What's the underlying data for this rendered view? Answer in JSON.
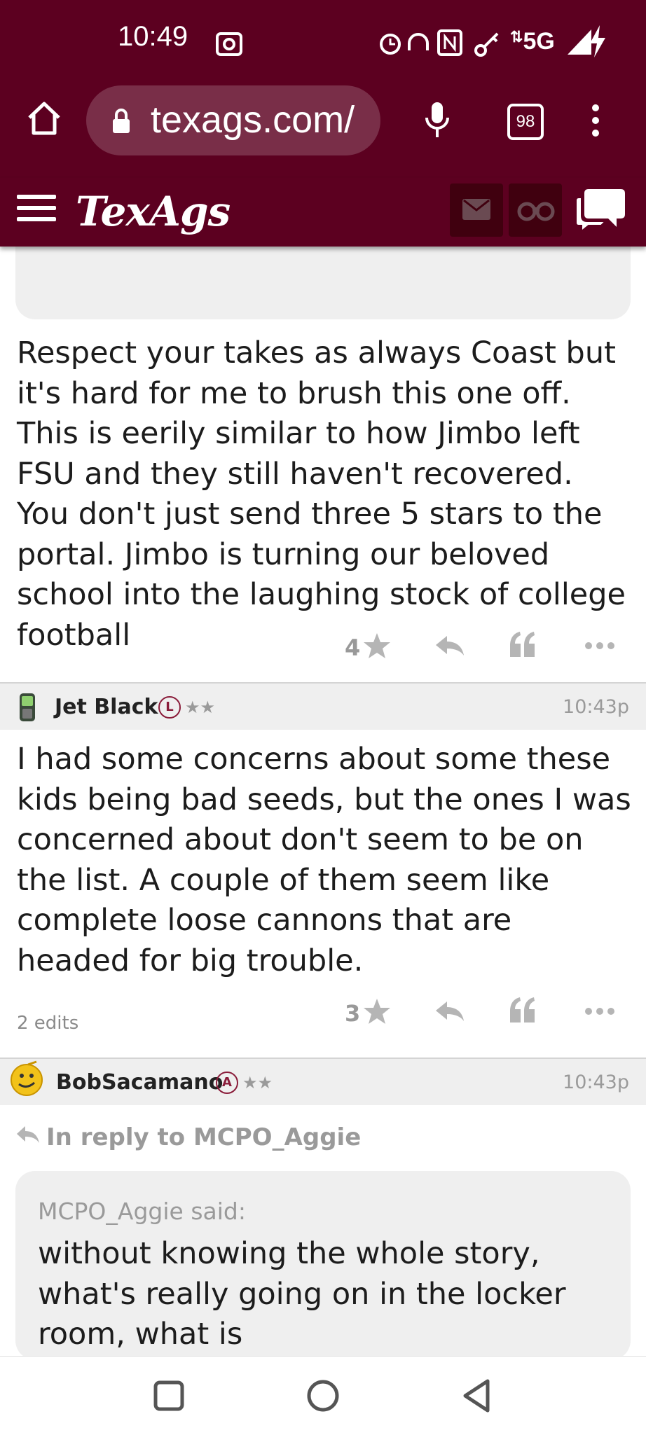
{
  "status": {
    "time": "10:49",
    "network": "5G"
  },
  "browser": {
    "url": "texags.com/",
    "tab_count": "98"
  },
  "site": {
    "logo": "TexAgs"
  },
  "posts": [
    {
      "body": "Respect your takes as always Coast but it's hard for me to brush this one off. This is eerily similar to how Jimbo left FSU and they still haven't recovered. You don't just send three 5 stars to the portal. Jimbo is turning our beloved school into the laughing stock of college football",
      "star_count": "4"
    },
    {
      "username": "Jet Black",
      "badge": "L",
      "rank_stars": "★★",
      "time": "10:43p",
      "body": "I had some concerns about some these kids being bad seeds, but the ones I was concerned about don't seem to be on the list. A couple of them seem like complete loose cannons that are headed for big trouble.",
      "edits": "2 edits",
      "star_count": "3"
    },
    {
      "username": "BobSacamano",
      "badge": "A",
      "rank_stars": "★★",
      "time": "10:43p",
      "reply_to": "In reply to MCPO_Aggie",
      "quote_author": "MCPO_Aggie said:",
      "quote_text": "without knowing the whole story, what's really going on in the locker room, what is"
    }
  ],
  "colors": {
    "maroon": "#5c0020",
    "header_dark": "#40000f"
  }
}
